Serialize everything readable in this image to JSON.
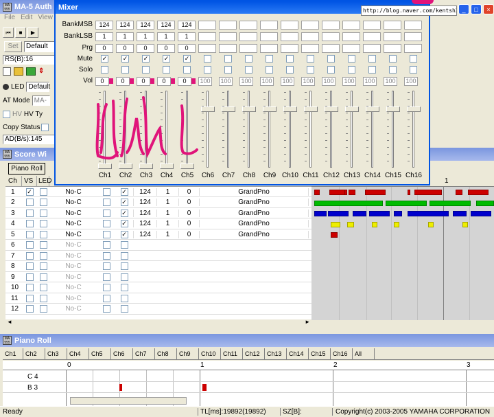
{
  "main_window": {
    "title": "MA-5 Auth",
    "menu": [
      "File",
      "Edit",
      "View"
    ],
    "set_label": "Set",
    "preset_value": "Default",
    "rs_value": "RS(B):16",
    "led_label": "LED",
    "led_value": "Default",
    "at_mode_label": "AT Mode",
    "at_mode_value": "MA-",
    "hv_label": "HV",
    "hv_type_label": "HV Ty",
    "copy_status_label": "Copy Status",
    "ad_value": "AD(B/s):145"
  },
  "mixer": {
    "title": "Mixer",
    "url": "http://blog.naver.com/kentsh2",
    "row_labels": {
      "bankmsb": "BankMSB",
      "banklsb": "BankLSB",
      "prg": "Prg",
      "mute": "Mute",
      "solo": "Solo",
      "vol": "Vol"
    },
    "channels": [
      {
        "name": "Ch1",
        "msb": "124",
        "lsb": "1",
        "prg": "0",
        "mute": true,
        "vol": "0",
        "active": true
      },
      {
        "name": "Ch2",
        "msb": "124",
        "lsb": "1",
        "prg": "0",
        "mute": true,
        "vol": "0",
        "active": true
      },
      {
        "name": "Ch3",
        "msb": "124",
        "lsb": "1",
        "prg": "0",
        "mute": true,
        "vol": "0",
        "active": true
      },
      {
        "name": "Ch4",
        "msb": "124",
        "lsb": "1",
        "prg": "0",
        "mute": true,
        "vol": "0",
        "active": true
      },
      {
        "name": "Ch5",
        "msb": "124",
        "lsb": "1",
        "prg": "0",
        "mute": true,
        "vol": "0",
        "active": true
      },
      {
        "name": "Ch6",
        "msb": "",
        "lsb": "",
        "prg": "",
        "mute": false,
        "vol": "100",
        "active": false
      },
      {
        "name": "Ch7",
        "msb": "",
        "lsb": "",
        "prg": "",
        "mute": false,
        "vol": "100",
        "active": false
      },
      {
        "name": "Ch8",
        "msb": "",
        "lsb": "",
        "prg": "",
        "mute": false,
        "vol": "100",
        "active": false
      },
      {
        "name": "Ch9",
        "msb": "",
        "lsb": "",
        "prg": "",
        "mute": false,
        "vol": "100",
        "active": false
      },
      {
        "name": "Ch10",
        "msb": "",
        "lsb": "",
        "prg": "",
        "mute": false,
        "vol": "100",
        "active": false
      },
      {
        "name": "Ch11",
        "msb": "",
        "lsb": "",
        "prg": "",
        "mute": false,
        "vol": "100",
        "active": false
      },
      {
        "name": "Ch12",
        "msb": "",
        "lsb": "",
        "prg": "",
        "mute": false,
        "vol": "100",
        "active": false
      },
      {
        "name": "Ch13",
        "msb": "",
        "lsb": "",
        "prg": "",
        "mute": false,
        "vol": "100",
        "active": false
      },
      {
        "name": "Ch14",
        "msb": "",
        "lsb": "",
        "prg": "",
        "mute": false,
        "vol": "100",
        "active": false
      },
      {
        "name": "Ch15",
        "msb": "",
        "lsb": "",
        "prg": "",
        "mute": false,
        "vol": "100",
        "active": false
      },
      {
        "name": "Ch16",
        "msb": "",
        "lsb": "",
        "prg": "",
        "mute": false,
        "vol": "100",
        "active": false
      }
    ]
  },
  "score_window": {
    "title": "Score Wi",
    "tab_label": "Piano Roll",
    "headers": [
      "Ch",
      "VS",
      "LED"
    ],
    "marker": "1",
    "rows": [
      {
        "ch": "1",
        "vs": true,
        "note": "No-C",
        "checked": true,
        "msb": "124",
        "lsb": "1",
        "prg": "0",
        "voice": "GrandPno"
      },
      {
        "ch": "2",
        "vs": false,
        "note": "No-C",
        "checked": true,
        "msb": "124",
        "lsb": "1",
        "prg": "0",
        "voice": "GrandPno"
      },
      {
        "ch": "3",
        "vs": false,
        "note": "No-C",
        "checked": true,
        "msb": "124",
        "lsb": "1",
        "prg": "0",
        "voice": "GrandPno"
      },
      {
        "ch": "4",
        "vs": false,
        "note": "No-C",
        "checked": true,
        "msb": "124",
        "lsb": "1",
        "prg": "0",
        "voice": "GrandPno"
      },
      {
        "ch": "5",
        "vs": false,
        "note": "No-C",
        "checked": true,
        "msb": "124",
        "lsb": "1",
        "prg": "0",
        "voice": "GrandPno"
      },
      {
        "ch": "6",
        "vs": false,
        "note": "No-C",
        "checked": false,
        "msb": "",
        "lsb": "",
        "prg": "",
        "voice": ""
      },
      {
        "ch": "7",
        "vs": false,
        "note": "No-C",
        "checked": false,
        "msb": "",
        "lsb": "",
        "prg": "",
        "voice": ""
      },
      {
        "ch": "8",
        "vs": false,
        "note": "No-C",
        "checked": false,
        "msb": "",
        "lsb": "",
        "prg": "",
        "voice": ""
      },
      {
        "ch": "9",
        "vs": false,
        "note": "No-C",
        "checked": false,
        "msb": "",
        "lsb": "",
        "prg": "",
        "voice": ""
      },
      {
        "ch": "10",
        "vs": false,
        "note": "No-C",
        "checked": false,
        "msb": "",
        "lsb": "",
        "prg": "",
        "voice": ""
      },
      {
        "ch": "11",
        "vs": false,
        "note": "No-C",
        "checked": false,
        "msb": "",
        "lsb": "",
        "prg": "",
        "voice": ""
      },
      {
        "ch": "12",
        "vs": false,
        "note": "No-C",
        "checked": false,
        "msb": "",
        "lsb": "",
        "prg": "",
        "voice": ""
      }
    ]
  },
  "piano_roll": {
    "title": "Piano Roll",
    "tabs": [
      "Ch1",
      "Ch2",
      "Ch3",
      "Ch4",
      "Ch5",
      "Ch6",
      "Ch7",
      "Ch8",
      "Ch9",
      "Ch10",
      "Ch11",
      "Ch12",
      "Ch13",
      "Ch14",
      "Ch15",
      "Ch16",
      "All"
    ],
    "ruler": [
      "0",
      "1",
      "2",
      "3"
    ],
    "keys": [
      "C 4",
      "B 3"
    ]
  },
  "status_bar": {
    "ready": "Ready",
    "tl": "TL[ms]:19892(19892)",
    "sz": "SZ[B]:",
    "copyright": "Copyright(c) 2003-2005 YAMAHA CORPORATION"
  },
  "colors": {
    "titlebar": "#0a246a",
    "note_red": "#cc0000",
    "note_green": "#00bb00",
    "note_blue": "#0000cc",
    "note_yellow": "#eeee00",
    "scribble": "#e0147a"
  }
}
